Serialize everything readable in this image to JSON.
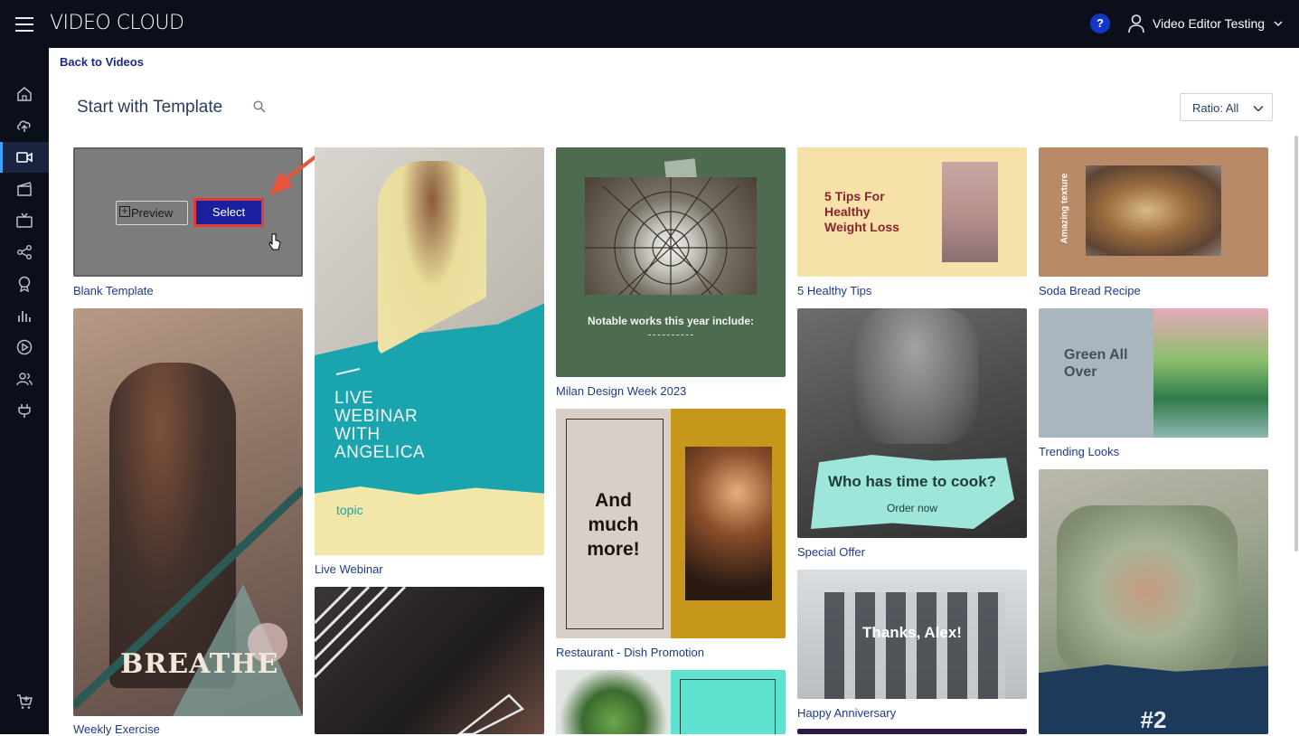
{
  "app": {
    "brand": "VIDEO CLOUD",
    "help": "?",
    "user": "Video Editor Testing"
  },
  "nav": {
    "back": "Back to Videos"
  },
  "page": {
    "title": "Start with Template",
    "ratio": "Ratio: All"
  },
  "blank": {
    "preview": "Preview",
    "select": "Select"
  },
  "templates": {
    "blank": "Blank Template",
    "weekly": "Weekly Exercise",
    "webinar": "Live Webinar",
    "milan": "Milan Design Week 2023",
    "restaurant": "Restaurant - Dish Promotion",
    "tips": "5 Healthy Tips",
    "offer": "Special Offer",
    "anniv": "Happy Anniversary",
    "soda": "Soda Bread Recipe",
    "trending": "Trending Looks"
  },
  "thumb": {
    "breathe": "BREATHE",
    "webinar_line1": "LIVE",
    "webinar_line2": "WEBINAR",
    "webinar_line3": "WITH",
    "webinar_line4": "ANGELICA",
    "webinar_topic": "topic",
    "milan_text": "Notable works this year include:",
    "rest_line1": "And",
    "rest_line2": "much",
    "rest_line3": "more!",
    "tips_line1": "5 Tips For",
    "tips_line2": "Healthy",
    "tips_line3": "Weight Loss",
    "offer_title": "Who has time to cook?",
    "offer_sub": "Order now",
    "anniv_text": "Thanks, Alex!",
    "soda_side": "Amazing texture",
    "green_line1": "Green All",
    "green_line2": "Over",
    "rank": "#2"
  },
  "colors": {
    "accent": "#1237c8",
    "select": "#1a1f9e",
    "highlight": "#e23b3b",
    "link": "#1e3a8a"
  }
}
